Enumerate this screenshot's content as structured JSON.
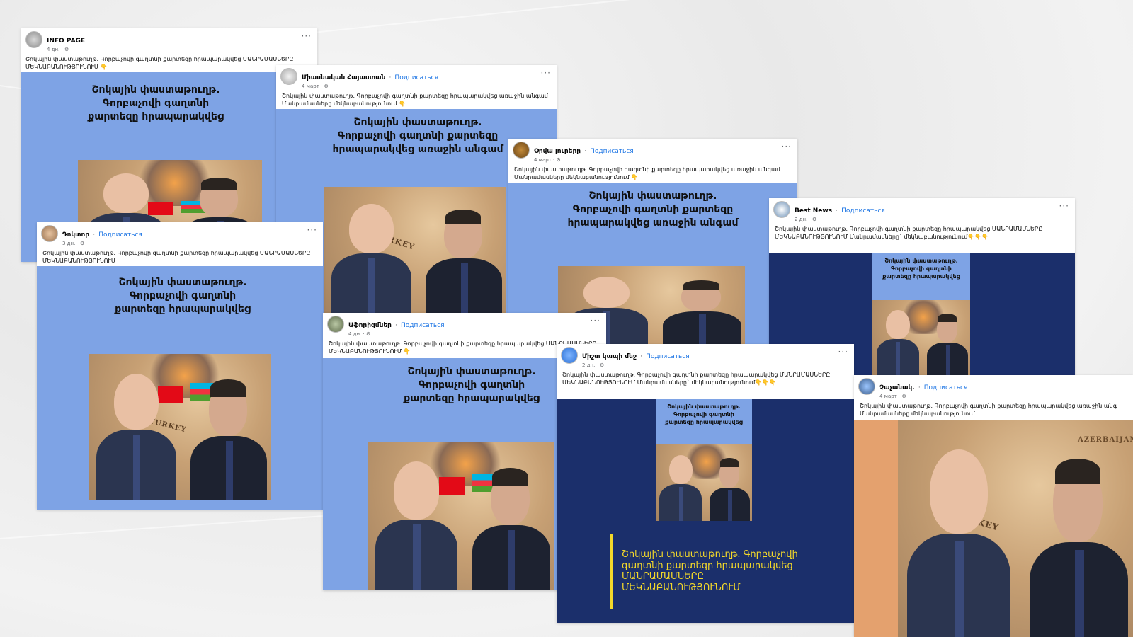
{
  "headline_short": "Շոկային փաստաթուղթ. Գորբաչովի գաղտնի քարտեզը հրապարակվեց",
  "headline_first": "Շոկային փաստաթուղթ. Գորբաչովի գաղտնի քարտեզը հրապարակվեց առաջին անգամ",
  "card_lines_short": [
    "Շոկային փաստաթուղթ.",
    "Գորբաչովի գաղտնի",
    "քարտեզը հրապարակվեց"
  ],
  "card_lines_first": [
    "Շոկային փաստաթուղթ.",
    "Գորբաչովի գաղտնի քարտեզը",
    "հրապարակվեց առաջին անգամ"
  ],
  "map_label_turkey": "TURKEY",
  "map_label_az": "AZERBAIJAN",
  "follow_label": "Подписаться",
  "more_label": "···",
  "hand": "👇",
  "posts": [
    {
      "author": "INFO PAGE",
      "date": "4 дн. · ⚙",
      "text": "Շոկային փաստաթուղթ. Գորբաչովի գաղտնի քարտեզը հրապարակվեց  ՄԱՆՐԱՄԱՍՆԵՐԸ ՄԵԿՆԱԲԱՆՈՒԹՅՈՒՆՈՒՄ"
    },
    {
      "author": "Միասնական Հայաստան",
      "date": "4 март · ⚙",
      "text": "Շոկային փաստաթուղթ. Գորբաչովի գաղտնի քարտեզը հրապարակվեց առաջին անգամ Մանրամասները մեկնաբանությունում"
    },
    {
      "author": "Օրվա լուրերը",
      "date": "4 март · ⚙",
      "text": "Շոկային փաստաթուղթ. Գորբաչովի գաղտնի քարտեզը հրապարակվեց առաջին անգամ Մանրամասները մեկնաբանությունում"
    },
    {
      "author": "Դոկտոր",
      "date": "3 дн. · ⚙",
      "text": "Շոկային փաստաթուղթ. Գորբաչովի գաղտնի քարտեզը հրապարակվեց ՄԱՆՐԱՄԱՍՆԵՐԸ ՄԵԿՆԱԲԱՆՈՒԹՅՈՒՆՈՒՄ"
    },
    {
      "author": "Best News",
      "date": "2 дн. · ⚙",
      "text": "Շոկային փաստաթուղթ. Գորբաչովի գաղտնի քարտեզը հրապարակվեց ՄԱՆՐԱՄԱՍՆԵՐԸ ՄԵԿՆԱԲԱՆՈՒԹՅՈՒՆՈՒՄ Մանրամասները` մեկնաբանությունում",
      "hands": "👇👇👇"
    },
    {
      "author": "Աֆորիզմներ",
      "date": "4 дн. · ⚙",
      "text": "Շոկային փաստաթուղթ. Գորբաչովի գաղտնի քարտեզը հրապարակվեց  ՄԱՆՐԱՄԱՍՆԵՐԸ ՄԵԿՆԱԲԱՆՈՒԹՅՈՒՆՈՒՄ"
    },
    {
      "author": "Միշտ կապի մեջ",
      "date": "2 дн. · ⚙",
      "text": "Շոկային փաստաթուղթ. Գորբաչովի գաղտնի քարտեզը հրապարակվեց ՄԱՆՐԱՄԱՍՆԵՐԸ ՄԵԿՆԱԲԱՆՈՒԹՅՈՒՆՈՒՄ Մանրամասները` մեկնաբանությունում",
      "hands": "👇👇👇"
    },
    {
      "author": "Չաչանակ.",
      "date": "4 март · ⚙",
      "text": "Շոկային փաստաթուղթ. Գորբաչովի գաղտնի քարտեզը հրապարակվեց առաջին անգ Մանրամասները մեկնաբանությունում"
    }
  ],
  "navy_caption": "Շոկային փաստաթուղթ. Գորբաչովի գաղտնի քարտեզը հրապարակվեց ՄԱՆՐԱՄԱՍՆԵՐԸ ՄԵԿՆԱԲԱՆՈՒԹՅՈՒՆՈՒՄ",
  "colors": {
    "card_blue": "#7ea3e5",
    "card_navy": "#1b2f6b",
    "link_blue": "#1b74e4",
    "accent_yellow": "#f3d82a"
  }
}
